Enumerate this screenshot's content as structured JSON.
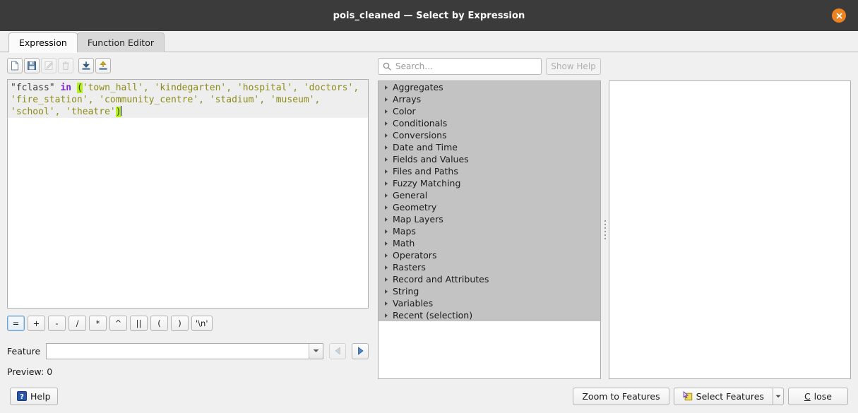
{
  "titlebar": {
    "title": "pois_cleaned — Select by Expression",
    "close_icon": "close-circle-icon"
  },
  "tabs": [
    {
      "label": "Expression",
      "active": true
    },
    {
      "label": "Function Editor",
      "active": false
    }
  ],
  "expression_toolbar": [
    {
      "name": "new-expression-button",
      "icon": "new-file-icon",
      "enabled": true
    },
    {
      "name": "save-expression-button",
      "icon": "floppy-save-icon",
      "enabled": true
    },
    {
      "name": "edit-expression-button",
      "icon": "pencil-edit-icon",
      "enabled": false
    },
    {
      "name": "delete-expression-button",
      "icon": "trash-icon",
      "enabled": false
    },
    {
      "name": "import-expressions-button",
      "icon": "import-down-arrow-icon",
      "enabled": true
    },
    {
      "name": "export-expressions-button",
      "icon": "export-up-arrow-icon",
      "enabled": true
    }
  ],
  "expression": {
    "text": "\"fclass\" in ('town_hall', 'kindegarten', 'hospital', 'doctors', 'fire_station', 'community_centre', 'stadium', 'museum', 'school', 'theatre')",
    "field": "\"fclass\"",
    "keyword": "in",
    "open_paren": "(",
    "close_paren": ")",
    "values": [
      "'town_hall'",
      "'kindegarten'",
      "'hospital'",
      "'doctors'",
      "'fire_station'",
      "'community_centre'",
      "'stadium'",
      "'museum'",
      "'school'",
      "'theatre'"
    ],
    "highlight_color": "#b5f21a",
    "keyword_color": "#7d26cd",
    "string_color": "#8b8b1a"
  },
  "operators": [
    {
      "label": "=",
      "focused": true
    },
    {
      "label": "+",
      "focused": false
    },
    {
      "label": "-",
      "focused": false
    },
    {
      "label": "/",
      "focused": false
    },
    {
      "label": "*",
      "focused": false
    },
    {
      "label": "^",
      "focused": false
    },
    {
      "label": "||",
      "focused": false
    },
    {
      "label": "(",
      "focused": false
    },
    {
      "label": ")",
      "focused": false
    },
    {
      "label": "'\\n'",
      "focused": false
    }
  ],
  "feature": {
    "label": "Feature",
    "value": "",
    "placeholder": "",
    "prev_icon": "triangle-left-icon",
    "next_icon": "triangle-right-icon",
    "prev_enabled": false,
    "next_enabled": true
  },
  "preview": {
    "label": "Preview:",
    "value": "0"
  },
  "search": {
    "placeholder": "Search…",
    "value": "",
    "icon": "search-icon"
  },
  "show_help": {
    "label": "Show Help",
    "enabled": false
  },
  "function_tree": [
    {
      "label": "Aggregates"
    },
    {
      "label": "Arrays"
    },
    {
      "label": "Color"
    },
    {
      "label": "Conditionals"
    },
    {
      "label": "Conversions"
    },
    {
      "label": "Date and Time"
    },
    {
      "label": "Fields and Values"
    },
    {
      "label": "Files and Paths"
    },
    {
      "label": "Fuzzy Matching"
    },
    {
      "label": "General"
    },
    {
      "label": "Geometry"
    },
    {
      "label": "Map Layers"
    },
    {
      "label": "Maps"
    },
    {
      "label": "Math"
    },
    {
      "label": "Operators"
    },
    {
      "label": "Rasters"
    },
    {
      "label": "Record and Attributes"
    },
    {
      "label": "String"
    },
    {
      "label": "Variables"
    },
    {
      "label": "Recent (selection)"
    }
  ],
  "help_panel": {
    "content": ""
  },
  "footer": {
    "help_label": "Help",
    "help_icon": "question-mark-icon",
    "zoom_to_features_label": "Zoom to Features",
    "select_features_label": "Select Features",
    "select_features_icon": "select-features-icon",
    "select_features_dropdown_icon": "chevron-down-icon",
    "close_label_prefix": "C",
    "close_label_rest": "lose"
  }
}
